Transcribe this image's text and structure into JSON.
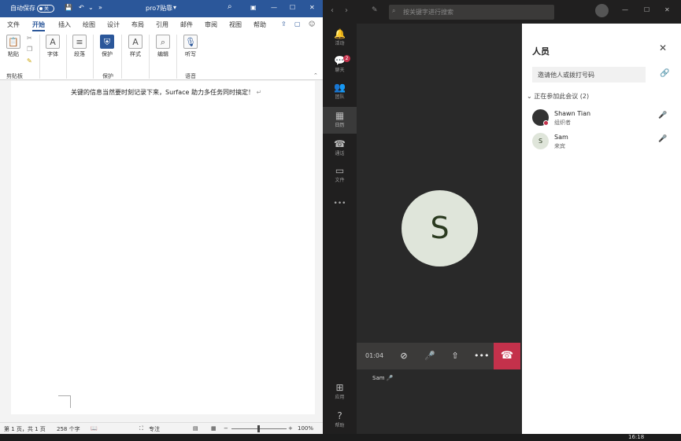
{
  "word": {
    "autosave_label": "自动保存",
    "autosave_state": "关",
    "doc_title": "pro7贴靠",
    "title_chevron": "▾",
    "overflow": "»",
    "tabs": [
      "文件",
      "开始",
      "插入",
      "绘图",
      "设计",
      "布局",
      "引用",
      "邮件",
      "审阅",
      "视图",
      "帮助"
    ],
    "ribbon": {
      "paste": "粘贴",
      "font": "字体",
      "paragraph": "段落",
      "protect": "保护",
      "styles": "样式",
      "edit": "编辑",
      "dictate": "听写",
      "group_clipboard": "剪贴板",
      "group_protect": "保护",
      "group_voice": "语音"
    },
    "doc_text": "关键的信息当然要时刻记录下来，Surface 助力多任务同时搞定！",
    "para_mark": "↵",
    "status": {
      "page": "第 1 页，共 1 页",
      "words": "258 个字",
      "focus": "专注",
      "zoom": "100%",
      "minus": "−",
      "plus": "+"
    }
  },
  "teams": {
    "search_placeholder": "按关键字进行搜索",
    "rail": [
      {
        "icon": "bell-icon",
        "glyph": "🔔",
        "label": "活动"
      },
      {
        "icon": "chat-icon",
        "glyph": "💬",
        "label": "聊天"
      },
      {
        "icon": "teams-icon",
        "glyph": "👥",
        "label": "团队"
      },
      {
        "icon": "calendar-icon",
        "glyph": "▦",
        "label": "日历"
      },
      {
        "icon": "phone-icon",
        "glyph": "☎",
        "label": "通话"
      },
      {
        "icon": "files-icon",
        "glyph": "▭",
        "label": "文件"
      }
    ],
    "rail_more": "•••",
    "rail_bottom": [
      {
        "label": "应用",
        "glyph": "⊞"
      },
      {
        "label": "帮助",
        "glyph": "?"
      }
    ],
    "chat_badge": "2",
    "avatar_letter": "S",
    "call_time": "01:04",
    "name_badge": "Sam",
    "people": {
      "title": "人员",
      "invite": "邀请他人或拨打号码",
      "section": "正在参加此会议 (2)",
      "members": [
        {
          "name": "Shawn Tian",
          "role": "组织者",
          "initial": "",
          "avatar_color": "#333333"
        },
        {
          "name": "Sam",
          "role": "来宾",
          "initial": "S",
          "avatar_color": "#dfe5da"
        }
      ]
    },
    "hangup_color": "#c4314b"
  },
  "taskbar": {
    "time": "16:18"
  }
}
